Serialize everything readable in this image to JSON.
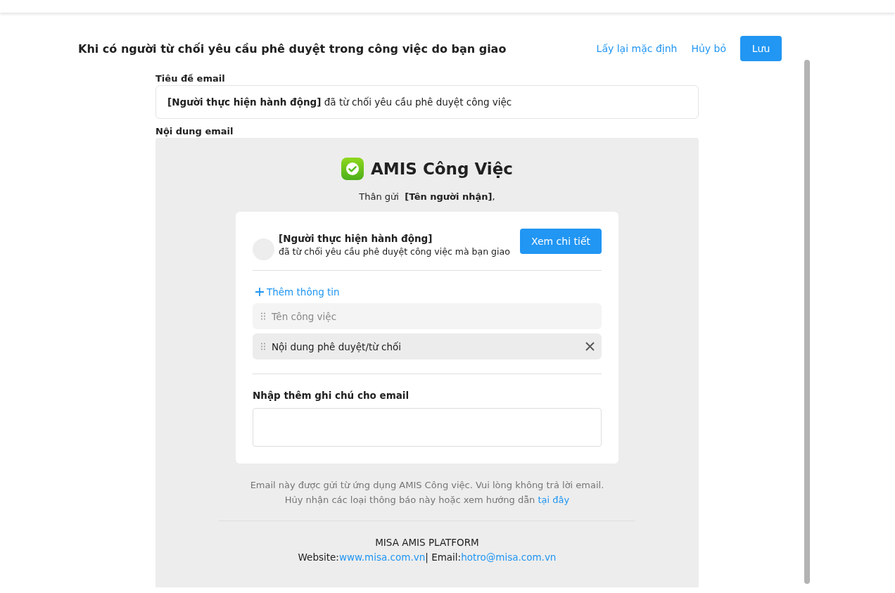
{
  "header": {
    "title": "Khi có người từ chối yêu cầu phê duyệt trong công việc do bạn giao",
    "actions": [
      {
        "label": "Lấy lại mặc định",
        "kind": "link"
      },
      {
        "label": "Hủy bỏ",
        "kind": "link"
      },
      {
        "label": "Lưu",
        "kind": "primary"
      }
    ]
  },
  "subject": {
    "label": "Tiêu đề email",
    "value": "**[Người thực hiện hành động]** đã từ chối yêu cầu phê duyệt công việc"
  },
  "body": {
    "label": "Nội dung email",
    "brand": "AMIS Công Việc",
    "greeting": "Thân gửi  **[Tên người nhận]**,",
    "card": {
      "actor": "[Người thực hiện hành động]",
      "message": "đã từ chối yêu cầu phê duyệt công việc mà bạn giao",
      "button": "Xem chi tiết",
      "add_label": "Thêm thông tin",
      "fields": [
        {
          "label": "Tên công việc",
          "kind": "fixed"
        },
        {
          "label": "Nội dung phê duyệt/từ chối",
          "kind": "removable"
        }
      ],
      "note_label": "Nhập thêm ghi chú cho email"
    },
    "footer": {
      "line_1": "Email này được gửi từ ứng dụng AMIS Công việc. Vui lòng không trả lời email.",
      "line_2": "Hủy nhận các loại thông báo này hoặc xem hướng dẫn",
      "line_2_link": "tại đây",
      "company": "MISA AMIS PLATFORM",
      "website_label": "Website:",
      "website": "www.misa.com.vn",
      "separator": "|",
      "email_label": "Email:",
      "email": "hotro@misa.com.vn"
    }
  }
}
